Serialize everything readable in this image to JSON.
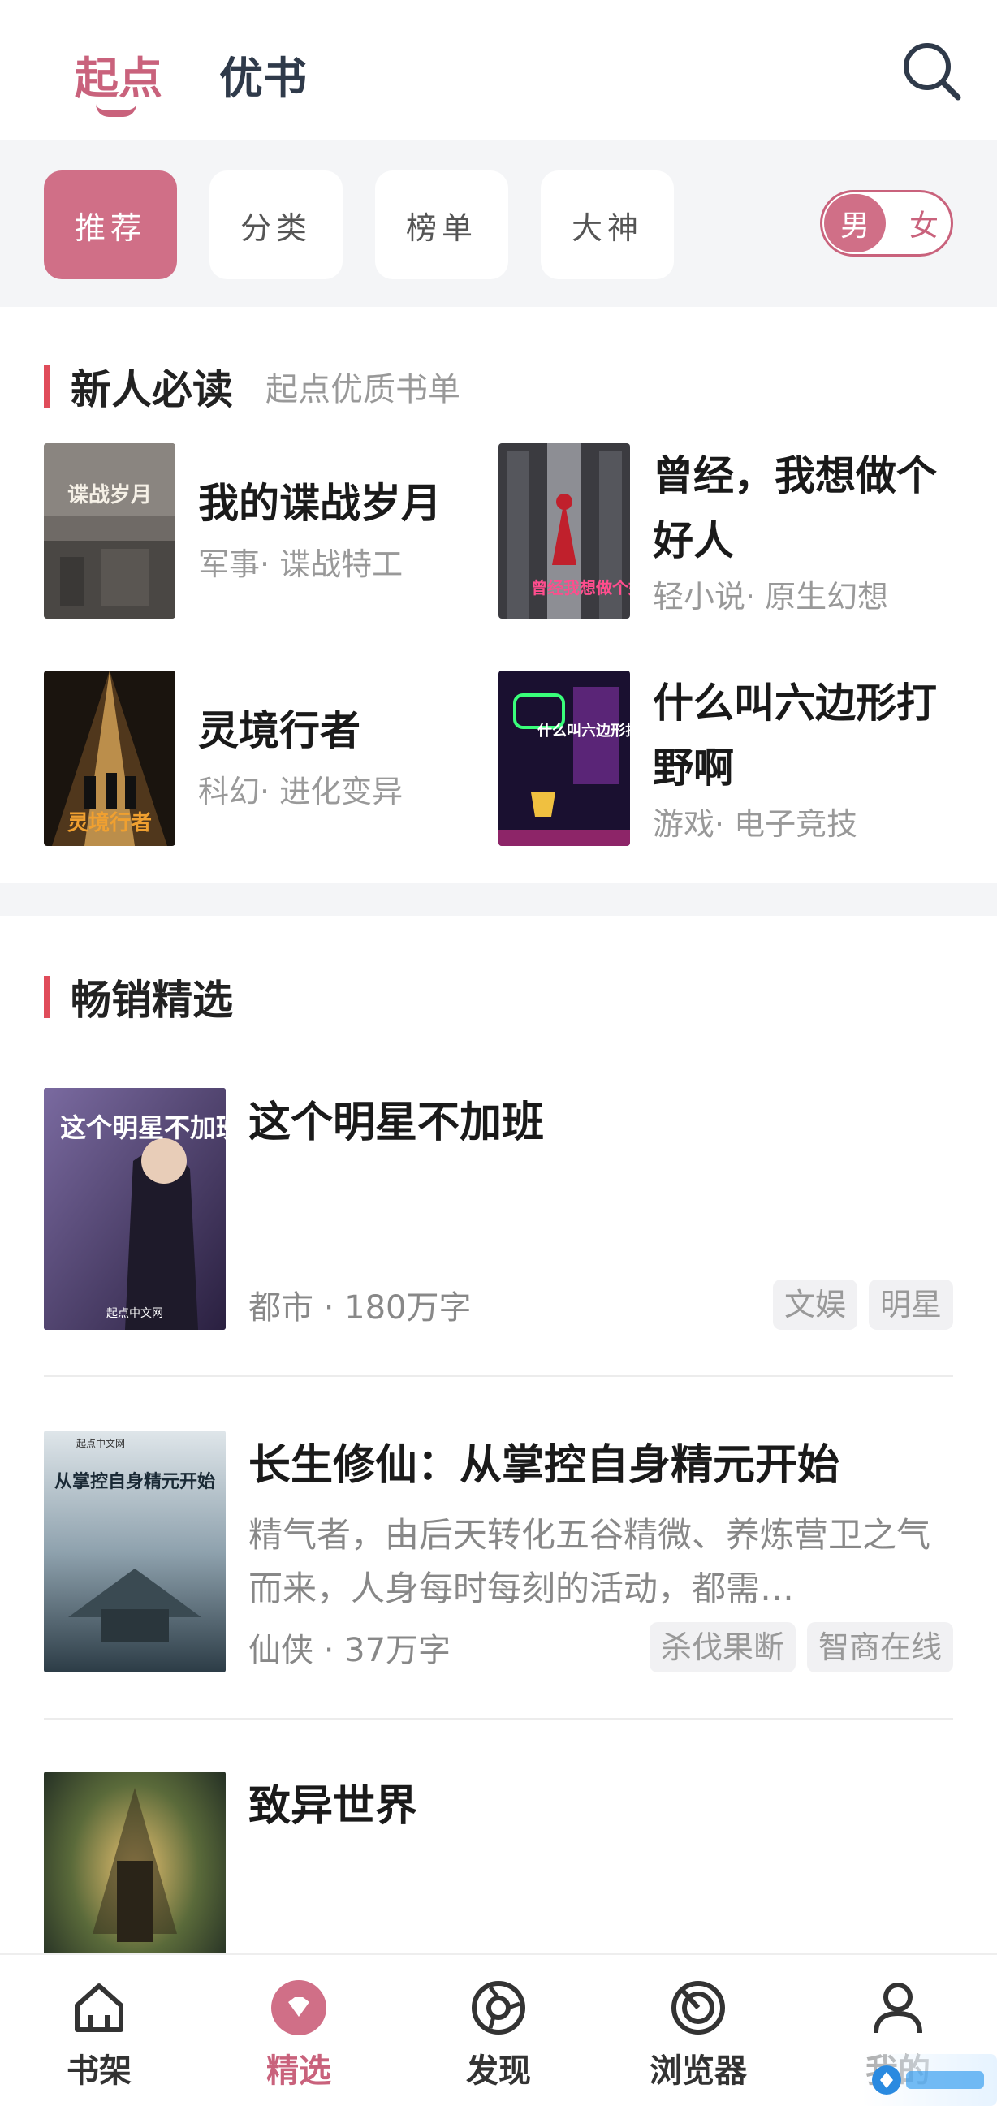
{
  "header": {
    "tab_active": "起点",
    "tab_other": "优书"
  },
  "filters": [
    "推荐",
    "分类",
    "榜单",
    "大神"
  ],
  "gender_toggle": {
    "on": "男",
    "off": "女"
  },
  "section1": {
    "title": "新人必读",
    "subtitle": "起点优质书单"
  },
  "grid_books": [
    {
      "title": "我的谍战岁月",
      "meta": "军事· 谍战特工",
      "cover_text": "谍战岁月"
    },
    {
      "title": "曾经，我想做个好人",
      "meta": "轻小说· 原生幻想",
      "cover_text": "曾经我想做个好人"
    },
    {
      "title": "灵境行者",
      "meta": "科幻· 进化变异",
      "cover_text": "灵境行者"
    },
    {
      "title": "什么叫六边形打野啊",
      "meta": "游戏· 电子竞技",
      "cover_text": "什么叫六边形打野"
    }
  ],
  "section2": {
    "title": "畅销精选"
  },
  "list_books": [
    {
      "title": "这个明星不加班",
      "desc": "",
      "meta": "都市 · 180万字",
      "tags": [
        "文娱",
        "明星"
      ],
      "cover_text": "这个明星不加班",
      "cover_brand": "起点中文网"
    },
    {
      "title": "长生修仙：从掌控自身精元开始",
      "desc": "精气者，由后天转化五谷精微、养炼营卫之气而来，人身每时每刻的活动，都需…",
      "meta": "仙侠 · 37万字",
      "tags": [
        "杀伐果断",
        "智商在线"
      ],
      "cover_text": "从掌控自身精元开始",
      "cover_brand": "起点中文网"
    },
    {
      "title": "致异世界",
      "desc": "",
      "meta": "",
      "tags": [],
      "cover_text": "",
      "cover_brand": ""
    }
  ],
  "bottom_nav": [
    {
      "label": "书架",
      "icon": "house-icon"
    },
    {
      "label": "精选",
      "icon": "diamond-icon"
    },
    {
      "label": "发现",
      "icon": "compass-icon"
    },
    {
      "label": "浏览器",
      "icon": "browser-icon"
    },
    {
      "label": "我的",
      "icon": "user-icon"
    }
  ],
  "colors": {
    "accent": "#c9627c",
    "accent_fill": "#d06f87",
    "section_bar": "#e04c5a"
  }
}
